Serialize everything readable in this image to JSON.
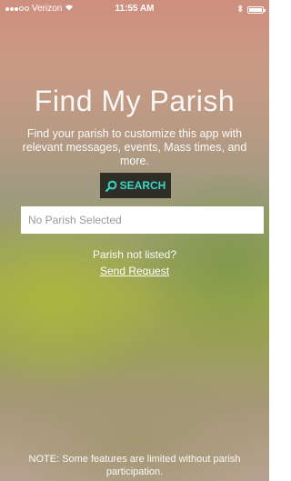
{
  "status_bar": {
    "carrier": "Verizon",
    "time": "11:55 AM"
  },
  "main": {
    "title": "Find My Parish",
    "description": "Find your parish to customize this app with relevant messages, events, Mass times, and more.",
    "search_button_label": "SEARCH",
    "parish_field": {
      "value": "",
      "placeholder": "No Parish Selected"
    },
    "not_listed_text": "Parish not listed?",
    "send_request_label": "Send Request",
    "note": "NOTE: Some features are limited without parish participation."
  },
  "colors": {
    "search_button_bg": "#2e2d26",
    "search_accent": "#38d6c6"
  },
  "icons": {
    "search": "search-icon",
    "wifi": "wifi-icon",
    "bluetooth": "bluetooth-icon",
    "battery": "battery-icon"
  }
}
